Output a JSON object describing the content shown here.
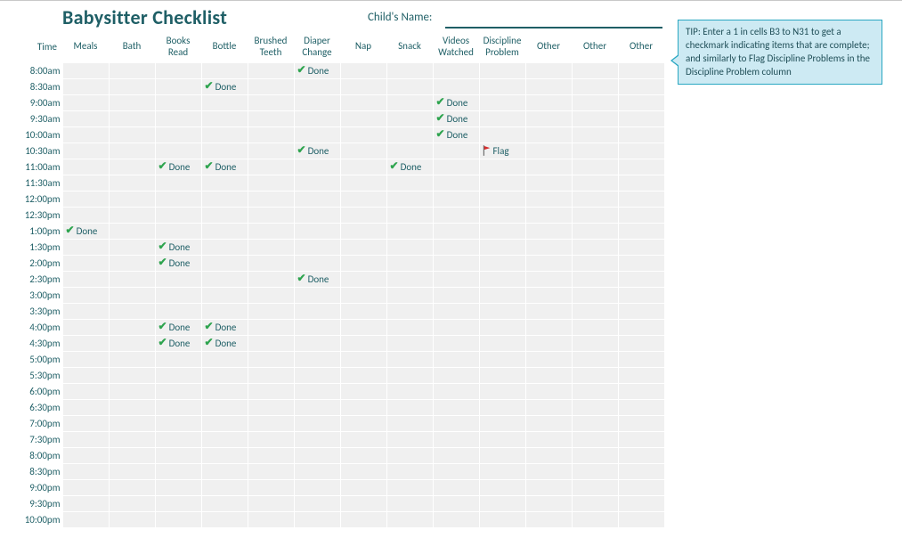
{
  "title": "Babysitter Checklist",
  "child_name_label": "Child's Name:",
  "child_name_value": "",
  "tip_text": "TIP: Enter a 1 in cells B3 to N31 to get a checkmark indicating items that are complete; and similarly to Flag Discipline Problems in the Discipline Problem column",
  "done_label": "Done",
  "flag_label": "Flag",
  "columns": [
    "Time",
    "Meals",
    "Bath",
    "Books Read",
    "Bottle",
    "Brushed Teeth",
    "Diaper Change",
    "Nap",
    "Snack",
    "Videos Watched",
    "Discipline Problem",
    "Other",
    "Other",
    "Other"
  ],
  "times": [
    "8:00am",
    "8:30am",
    "9:00am",
    "9:30am",
    "10:00am",
    "10:30am",
    "11:00am",
    "11:30am",
    "12:00pm",
    "12:30pm",
    "1:00pm",
    "1:30pm",
    "2:00pm",
    "2:30pm",
    "3:00pm",
    "3:30pm",
    "4:00pm",
    "4:30pm",
    "5:00pm",
    "5:30pm",
    "6:00pm",
    "6:30pm",
    "7:00pm",
    "7:30pm",
    "8:00pm",
    "8:30pm",
    "9:00pm",
    "9:30pm",
    "10:00pm"
  ],
  "marks": {
    "8:00am": {
      "Diaper Change": "done"
    },
    "8:30am": {
      "Bottle": "done"
    },
    "9:00am": {
      "Videos Watched": "done"
    },
    "9:30am": {
      "Videos Watched": "done"
    },
    "10:00am": {
      "Videos Watched": "done"
    },
    "10:30am": {
      "Diaper Change": "done",
      "Discipline Problem": "flag"
    },
    "11:00am": {
      "Books Read": "done",
      "Bottle": "done",
      "Snack": "done"
    },
    "1:00pm": {
      "Meals": "done"
    },
    "1:30pm": {
      "Books Read": "done"
    },
    "2:00pm": {
      "Books Read": "done"
    },
    "2:30pm": {
      "Diaper Change": "done"
    },
    "4:00pm": {
      "Books Read": "done",
      "Bottle": "done"
    },
    "4:30pm": {
      "Books Read": "done",
      "Bottle": "done"
    }
  }
}
